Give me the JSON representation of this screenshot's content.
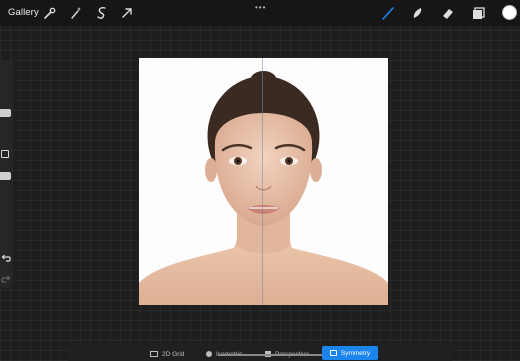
{
  "app": {
    "gallery_label": "Gallery",
    "more_menu_label": "•••"
  },
  "toolbar": {
    "left_tools": [
      "wrench-icon",
      "magic-wand-icon",
      "selection-icon",
      "transform-arrow-icon"
    ],
    "right_tools": [
      "brush-icon",
      "smudge-icon",
      "eraser-icon",
      "layers-icon"
    ],
    "active_tool": "brush-icon",
    "active_color": "#1a84ef",
    "current_color": "#ffffff"
  },
  "drawing_guide": {
    "options": [
      {
        "label": "2D Grid"
      },
      {
        "label": "Isometric"
      },
      {
        "label": "Perspective"
      },
      {
        "label": "Symmetry"
      }
    ],
    "selected": "Symmetry",
    "selected_color": "#1a84ef"
  }
}
